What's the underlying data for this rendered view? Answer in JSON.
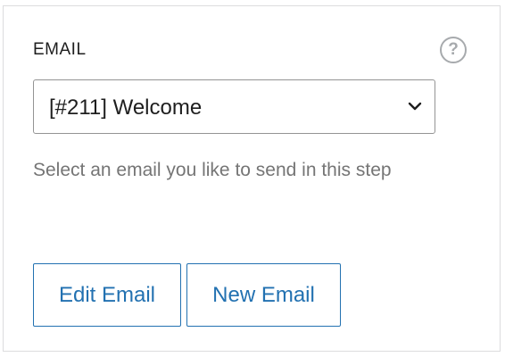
{
  "field": {
    "label": "EMAIL",
    "help_icon": "question-mark-circle-icon",
    "help_glyph": "?"
  },
  "select": {
    "value": "[#211] Welcome",
    "chevron_icon": "chevron-down-icon"
  },
  "help_text": "Select an email you like to send in this step",
  "buttons": {
    "edit_label": "Edit Email",
    "new_label": "New Email"
  },
  "colors": {
    "accent": "#2271b1",
    "text": "#1e1e1e",
    "muted_text": "#757575",
    "border": "#949494",
    "icon": "#a7aaad"
  }
}
